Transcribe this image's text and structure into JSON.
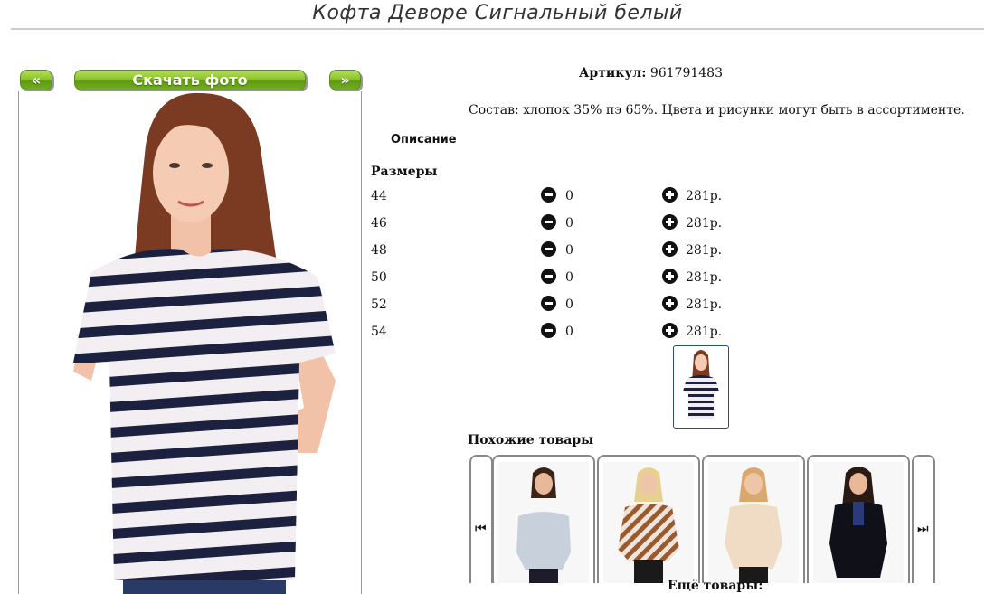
{
  "page": {
    "title": "Кофта Деворе Сигнальный белый"
  },
  "gallery": {
    "prev_label": "«",
    "next_label": "»",
    "download_label": "Скачать фото",
    "main_photo": "woman-striped-top-photo"
  },
  "product": {
    "sku_label": "Артикул:",
    "sku_value": "961791483",
    "composition": "Состав: хлопок 35% пэ 65%. Цвета и рисунки могут быть в ассортименте.",
    "description_label": "Описание",
    "sizes_heading": "Размеры",
    "sizes": [
      {
        "size": "44",
        "qty": "0",
        "price": "281р."
      },
      {
        "size": "46",
        "qty": "0",
        "price": "281р."
      },
      {
        "size": "48",
        "qty": "0",
        "price": "281р."
      },
      {
        "size": "50",
        "qty": "0",
        "price": "281р."
      },
      {
        "size": "52",
        "qty": "0",
        "price": "281р."
      },
      {
        "size": "54",
        "qty": "0",
        "price": "281р."
      }
    ]
  },
  "similar": {
    "heading": "Похожие товары",
    "prev_icon": "skip-back-icon",
    "next_icon": "skip-forward-icon",
    "items": [
      "light-blue-off-shoulder-top",
      "brown-striped-blouse",
      "beige-blouse",
      "black-lace-blouse"
    ]
  },
  "more": {
    "heading": "Ещё товары:"
  },
  "colors": {
    "accent_green": "#7fb522",
    "stripe_navy": "#1c2140",
    "border_gray": "#888888"
  }
}
